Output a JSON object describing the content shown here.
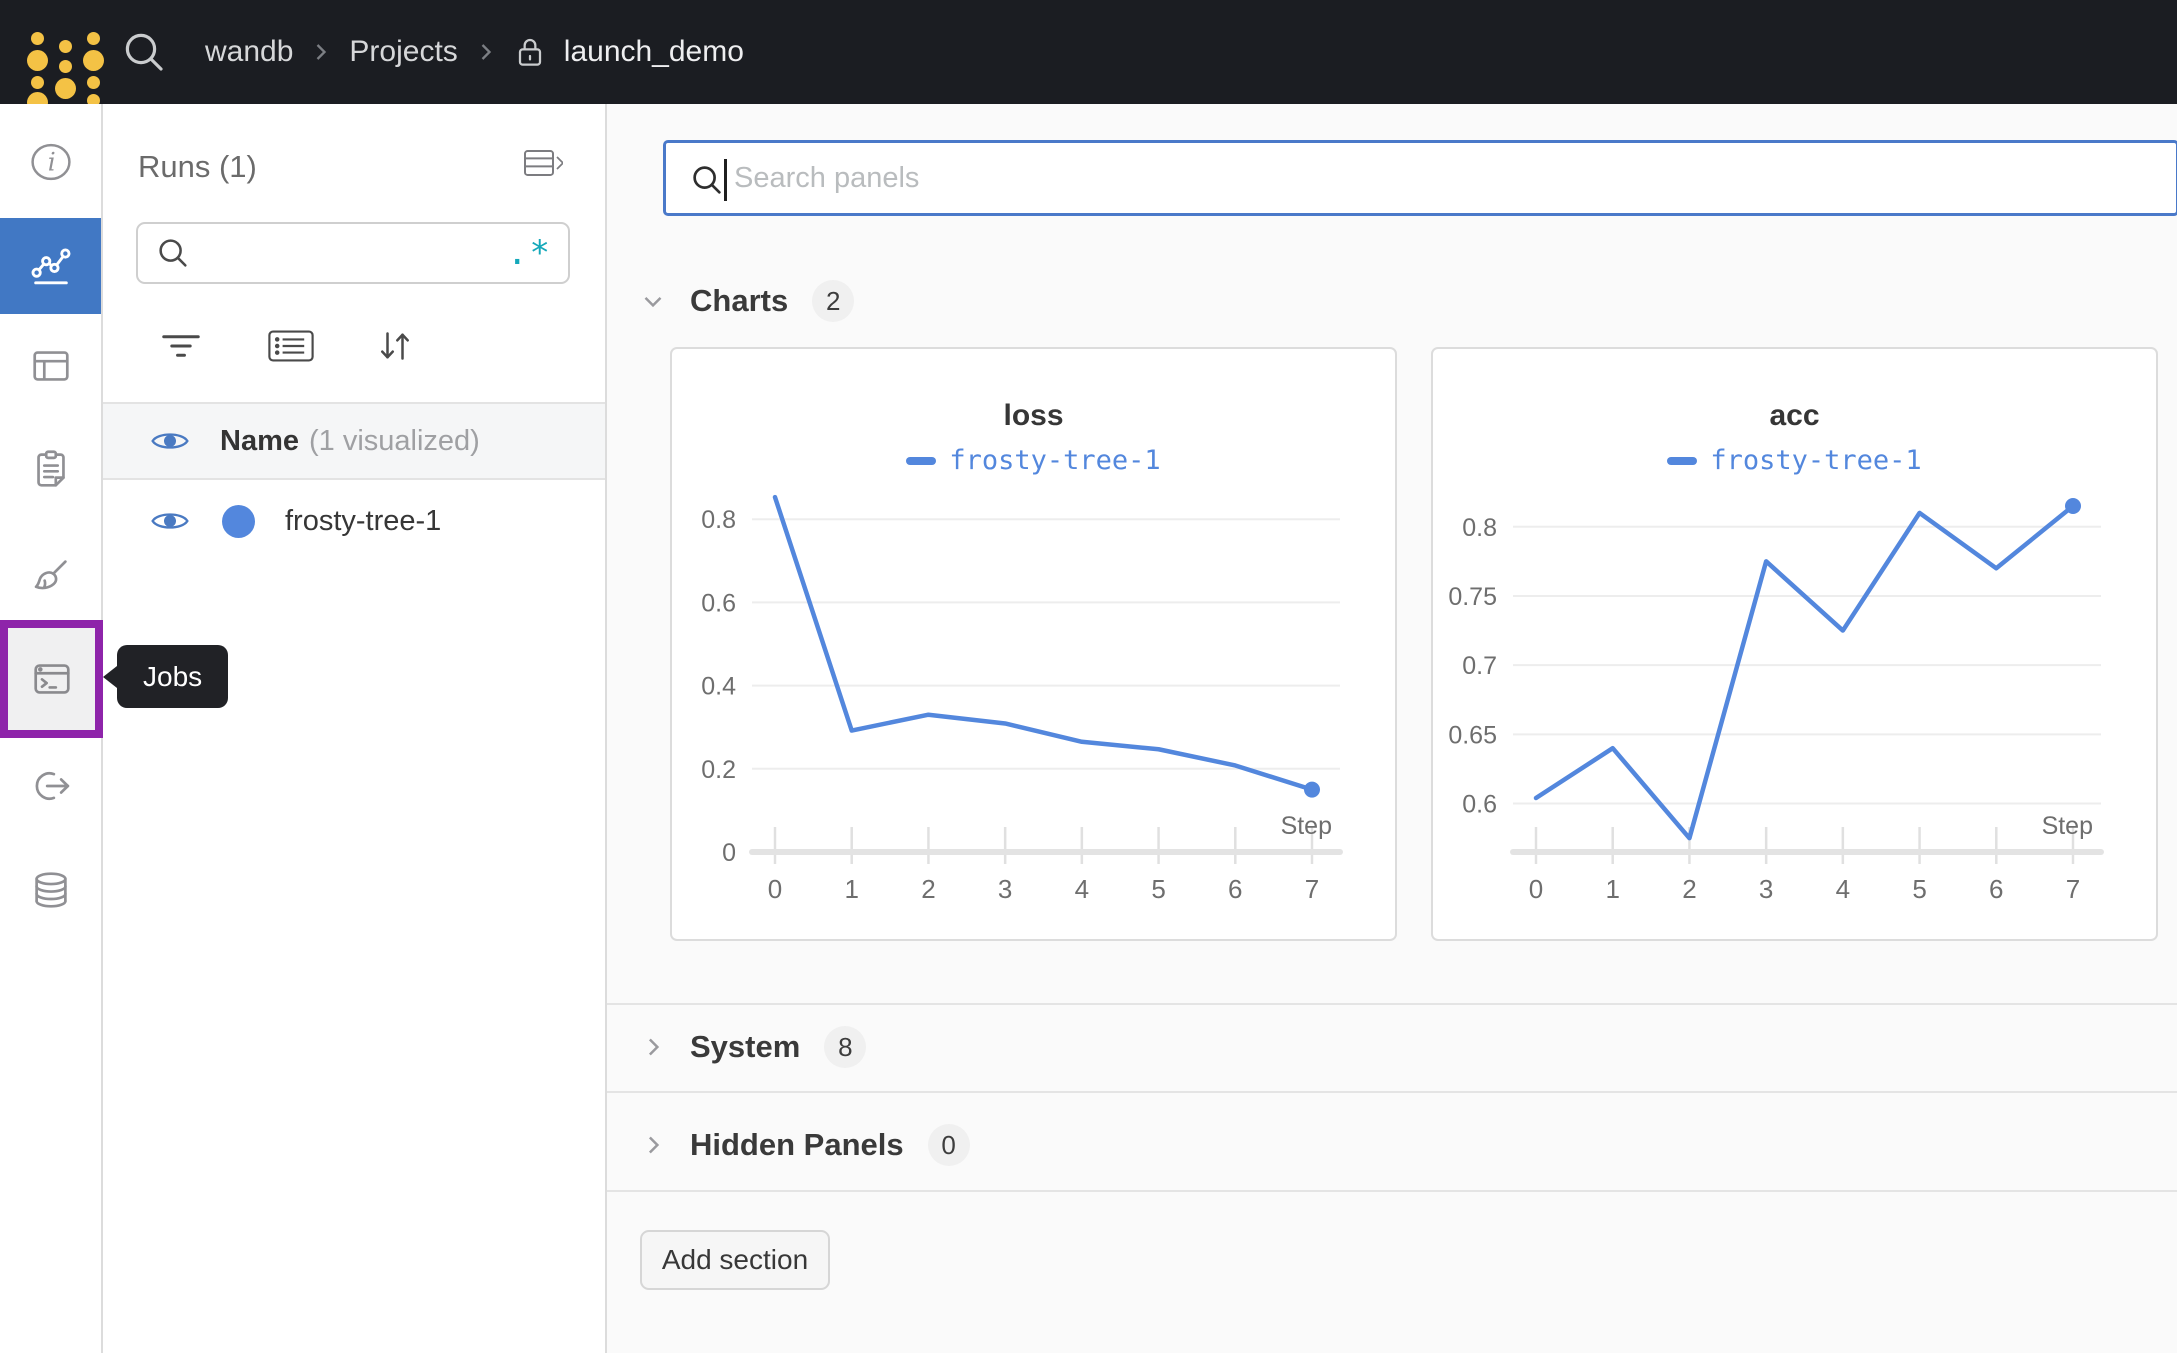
{
  "topbar": {
    "breadcrumb": {
      "items": [
        "wandb",
        "Projects",
        "launch_demo"
      ]
    }
  },
  "sidebar": {
    "tooltip": "Jobs",
    "items": [
      {
        "name": "overview",
        "icon": "info-icon",
        "active": false,
        "highlighted": false
      },
      {
        "name": "workspace",
        "icon": "line-chart-icon",
        "active": true,
        "highlighted": false
      },
      {
        "name": "runs-table",
        "icon": "table-icon",
        "active": false,
        "highlighted": false
      },
      {
        "name": "reports",
        "icon": "clipboard-icon",
        "active": false,
        "highlighted": false
      },
      {
        "name": "sweeps",
        "icon": "broom-icon",
        "active": false,
        "highlighted": false
      },
      {
        "name": "jobs",
        "icon": "terminal-icon",
        "active": false,
        "highlighted": true
      },
      {
        "name": "automations",
        "icon": "link-arrow-icon",
        "active": false,
        "highlighted": false
      },
      {
        "name": "artifacts",
        "icon": "database-icon",
        "active": false,
        "highlighted": false
      }
    ]
  },
  "runs_panel": {
    "title": "Runs (1)",
    "search": {
      "value": "",
      "placeholder": "",
      "regex_toggle": ".*"
    },
    "header": {
      "label": "Name",
      "annotation": "(1 visualized)"
    },
    "runs": [
      {
        "name": "frosty-tree-1",
        "color": "#5387DD",
        "visible": true
      }
    ]
  },
  "main": {
    "panel_search": {
      "value": "",
      "placeholder": "Search panels"
    },
    "sections": [
      {
        "label": "Charts",
        "count": 2,
        "expanded": true
      },
      {
        "label": "System",
        "count": 8,
        "expanded": false
      },
      {
        "label": "Hidden Panels",
        "count": 0,
        "expanded": false
      }
    ],
    "add_section_label": "Add section"
  },
  "chart_data": [
    {
      "type": "line",
      "title": "loss",
      "xlabel": "Step",
      "x": [
        0,
        1,
        2,
        3,
        4,
        5,
        6,
        7
      ],
      "series": [
        {
          "name": "frosty-tree-1",
          "color": "#5387DD",
          "values": [
            0.853,
            0.292,
            0.33,
            0.309,
            0.265,
            0.247,
            0.208,
            0.15
          ]
        }
      ],
      "ylim": [
        0,
        0.875
      ],
      "yticks": [
        0,
        0.2,
        0.4,
        0.6,
        0.8
      ],
      "grid": true,
      "legend_position": "top"
    },
    {
      "type": "line",
      "title": "acc",
      "xlabel": "Step",
      "x": [
        0,
        1,
        2,
        3,
        4,
        5,
        6,
        7
      ],
      "series": [
        {
          "name": "frosty-tree-1",
          "color": "#5387DD",
          "values": [
            0.604,
            0.64,
            0.575,
            0.775,
            0.725,
            0.81,
            0.77,
            0.815
          ]
        }
      ],
      "ylim": [
        0.565,
        0.828
      ],
      "yticks": [
        0.6,
        0.65,
        0.7,
        0.75,
        0.8
      ],
      "grid": true,
      "legend_position": "top"
    }
  ],
  "colors": {
    "topbar_bg": "#1b1d22",
    "accent_blue": "#4178c4",
    "run_blue": "#5387DD",
    "highlight_purple": "#8e24aa",
    "regex_teal": "#14a8ba",
    "logo_yellow": "#f4c245"
  }
}
